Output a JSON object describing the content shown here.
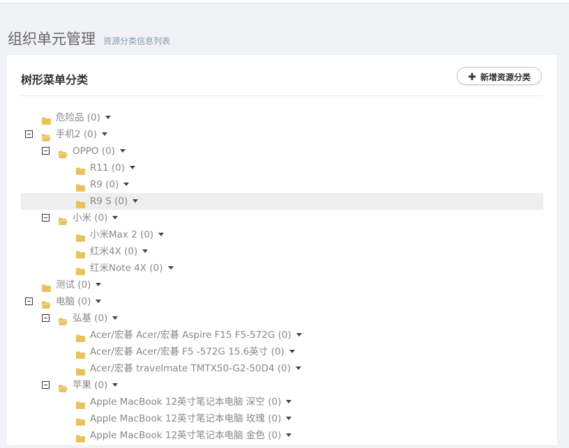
{
  "header": {
    "title": "组织单元管理",
    "subtitle": "资源分类信息列表"
  },
  "card": {
    "title": "树形菜单分类",
    "add_button_label": "新增资源分类"
  },
  "tree": [
    {
      "label": "危险品 (0)",
      "level": 0,
      "expanded": false,
      "has_children": false
    },
    {
      "label": "手机2 (0)",
      "level": 0,
      "expanded": true,
      "has_children": true
    },
    {
      "label": "OPPO (0)",
      "level": 1,
      "expanded": true,
      "has_children": true
    },
    {
      "label": "R11 (0)",
      "level": 2,
      "expanded": false,
      "has_children": false
    },
    {
      "label": "R9 (0)",
      "level": 2,
      "expanded": false,
      "has_children": false
    },
    {
      "label": "R9 S (0)",
      "level": 2,
      "expanded": false,
      "has_children": false,
      "highlighted": true
    },
    {
      "label": "小米 (0)",
      "level": 1,
      "expanded": true,
      "has_children": true
    },
    {
      "label": "小米Max 2 (0)",
      "level": 2,
      "expanded": false,
      "has_children": false
    },
    {
      "label": "红米4X (0)",
      "level": 2,
      "expanded": false,
      "has_children": false
    },
    {
      "label": "红米Note 4X (0)",
      "level": 2,
      "expanded": false,
      "has_children": false
    },
    {
      "label": "测试 (0)",
      "level": 0,
      "expanded": false,
      "has_children": false
    },
    {
      "label": "电脑 (0)",
      "level": 0,
      "expanded": true,
      "has_children": true
    },
    {
      "label": "弘基 (0)",
      "level": 1,
      "expanded": true,
      "has_children": true
    },
    {
      "label": "Acer/宏碁 Acer/宏碁 Aspire F15 F5-572G (0)",
      "level": 2,
      "expanded": false,
      "has_children": false
    },
    {
      "label": "Acer/宏碁 Acer/宏碁 F5 -572G 15.6英寸 (0)",
      "level": 2,
      "expanded": false,
      "has_children": false
    },
    {
      "label": "Acer/宏碁 travelmate TMTX50-G2-50D4 (0)",
      "level": 2,
      "expanded": false,
      "has_children": false
    },
    {
      "label": "苹果 (0)",
      "level": 1,
      "expanded": true,
      "has_children": true
    },
    {
      "label": "Apple MacBook 12英寸笔记本电脑 深空 (0)",
      "level": 2,
      "expanded": false,
      "has_children": false
    },
    {
      "label": "Apple MacBook 12英寸笔记本电脑 玫瑰 (0)",
      "level": 2,
      "expanded": false,
      "has_children": false
    },
    {
      "label": "Apple MacBook 12英寸笔记本电脑 金色 (0)",
      "level": 2,
      "expanded": false,
      "has_children": false
    }
  ],
  "colors": {
    "folder": "#e8c25c",
    "highlight": "#eeeeee",
    "label": "#888888"
  },
  "icons": {
    "folder_closed": "folder-icon",
    "folder_open": "folder-open-icon",
    "collapse": "minus-square-icon",
    "dropdown": "caret-down-icon",
    "add": "plus-icon"
  }
}
